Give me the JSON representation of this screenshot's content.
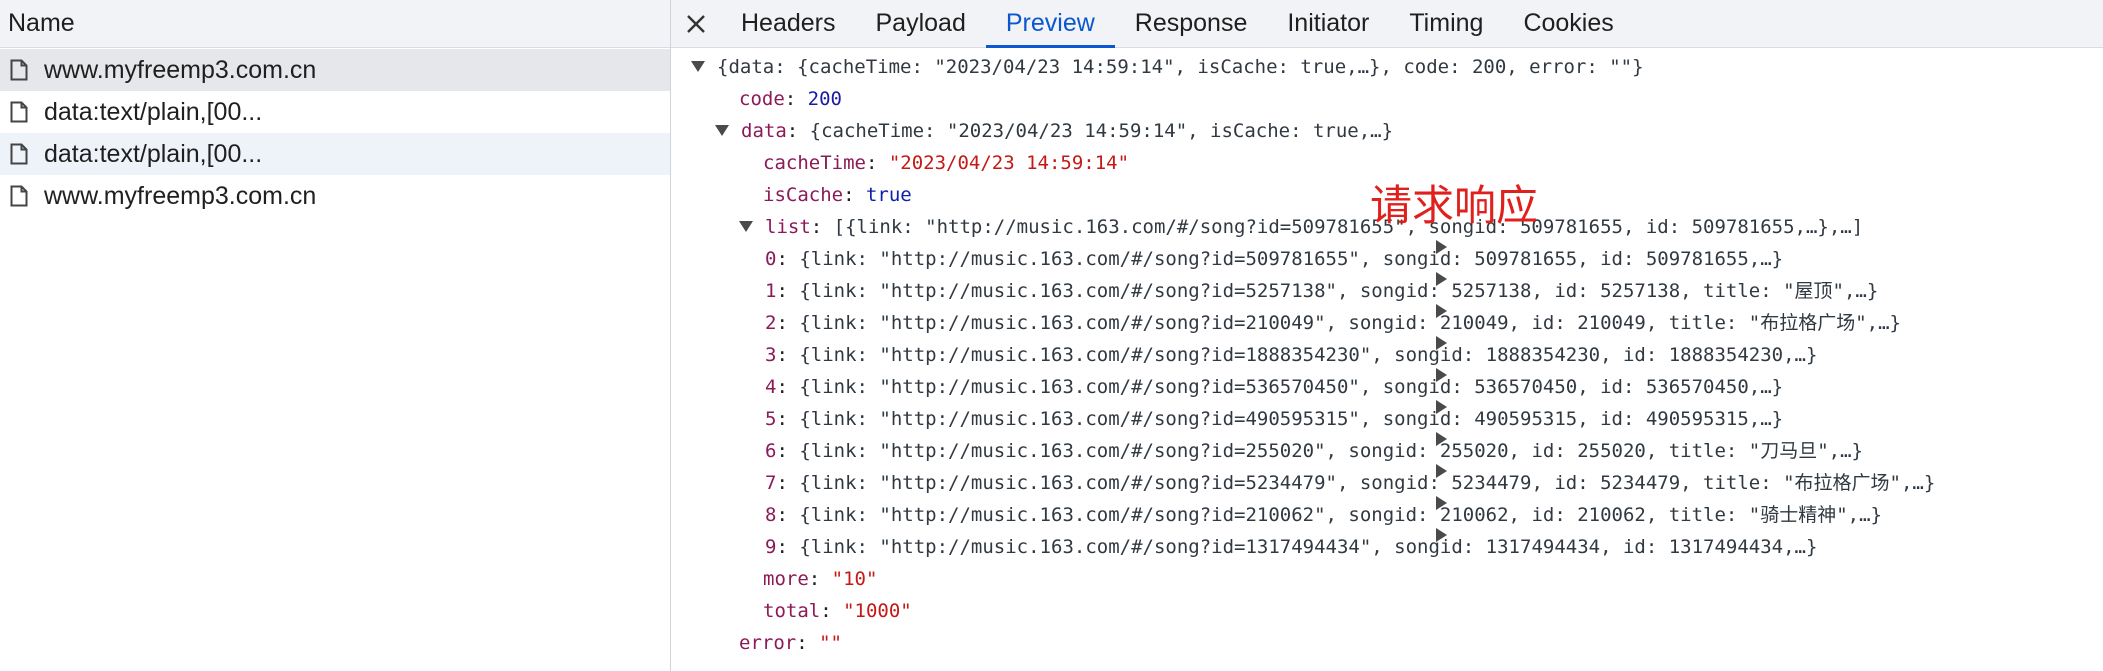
{
  "left_panel": {
    "header": "Name",
    "requests": [
      {
        "name": "www.myfreemp3.com.cn"
      },
      {
        "name": "data:text/plain,[00..."
      },
      {
        "name": "data:text/plain,[00..."
      },
      {
        "name": "www.myfreemp3.com.cn"
      }
    ]
  },
  "tabs": [
    "Headers",
    "Payload",
    "Preview",
    "Response",
    "Initiator",
    "Timing",
    "Cookies"
  ],
  "active_tab": "Preview",
  "annotation": "请求响应",
  "preview": {
    "root_summary": "{data: {cacheTime: \"2023/04/23 14:59:14\", isCache: true,…}, code: 200, error: \"\"}",
    "code_key": "code",
    "code_value": "200",
    "data_key": "data",
    "data_summary": "{cacheTime: \"2023/04/23 14:59:14\", isCache: true,…}",
    "cacheTime_key": "cacheTime",
    "cacheTime_value": "\"2023/04/23 14:59:14\"",
    "isCache_key": "isCache",
    "isCache_value": "true",
    "list_key": "list",
    "list_summary": "[{link: \"http://music.163.com/#/song?id=509781655\", songid: 509781655, id: 509781655,…},…]",
    "items": [
      {
        "index": "0",
        "summary": "{link: \"http://music.163.com/#/song?id=509781655\", songid: 509781655, id: 509781655,…}"
      },
      {
        "index": "1",
        "summary": "{link: \"http://music.163.com/#/song?id=5257138\", songid: 5257138, id: 5257138, title: \"屋顶\",…}"
      },
      {
        "index": "2",
        "summary": "{link: \"http://music.163.com/#/song?id=210049\", songid: 210049, id: 210049, title: \"布拉格广场\",…}"
      },
      {
        "index": "3",
        "summary": "{link: \"http://music.163.com/#/song?id=1888354230\", songid: 1888354230, id: 1888354230,…}"
      },
      {
        "index": "4",
        "summary": "{link: \"http://music.163.com/#/song?id=536570450\", songid: 536570450, id: 536570450,…}"
      },
      {
        "index": "5",
        "summary": "{link: \"http://music.163.com/#/song?id=490595315\", songid: 490595315, id: 490595315,…}"
      },
      {
        "index": "6",
        "summary": "{link: \"http://music.163.com/#/song?id=255020\", songid: 255020, id: 255020, title: \"刀马旦\",…}"
      },
      {
        "index": "7",
        "summary": "{link: \"http://music.163.com/#/song?id=5234479\", songid: 5234479, id: 5234479, title: \"布拉格广场\",…}"
      },
      {
        "index": "8",
        "summary": "{link: \"http://music.163.com/#/song?id=210062\", songid: 210062, id: 210062, title: \"骑士精神\",…}"
      },
      {
        "index": "9",
        "summary": "{link: \"http://music.163.com/#/song?id=1317494434\", songid: 1317494434, id: 1317494434,…}"
      }
    ],
    "more_key": "more",
    "more_value": "\"10\"",
    "total_key": "total",
    "total_value": "\"1000\"",
    "error_key": "error",
    "error_value": "\"\""
  }
}
